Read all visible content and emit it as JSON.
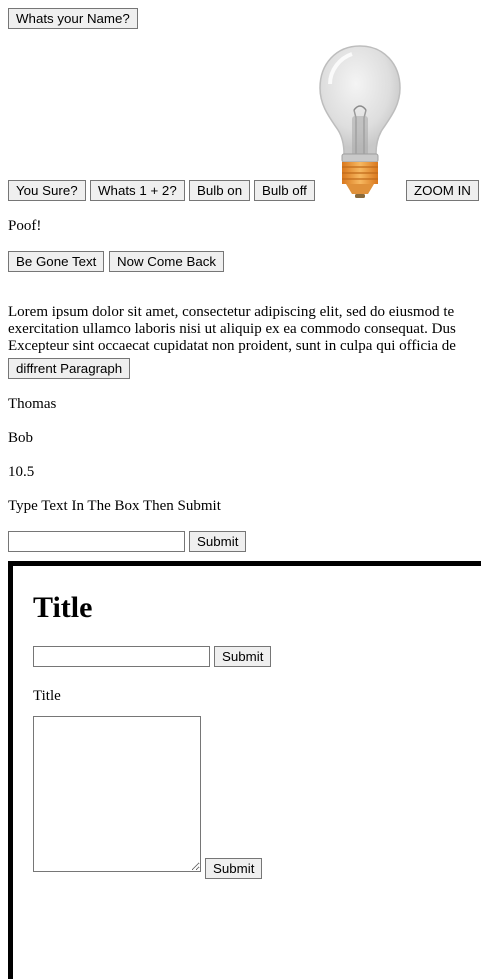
{
  "buttons": {
    "name": "Whats your Name?",
    "sure": "You Sure?",
    "math": "Whats 1 + 2?",
    "bulb_on": "Bulb on",
    "bulb_off": "Bulb off",
    "zoom_in": "ZOOM IN",
    "be_gone": "Be Gone Text",
    "come_back": "Now Come Back",
    "different_paragraph": "diffrent Paragraph",
    "submit": "Submit"
  },
  "texts": {
    "poof": "Poof!",
    "lorem_lines": [
      "Lorem ipsum dolor sit amet, consectetur adipiscing elit, sed do eiusmod te",
      "exercitation ullamco laboris nisi ut aliquip ex ea commodo consequat. Dus",
      "Excepteur sint occaecat cupidatat non proident, sunt in culpa qui officia de"
    ],
    "name1": "Thomas",
    "name2": "Bob",
    "number": "10.5",
    "instruction": "Type Text In The Box Then Submit"
  },
  "main_form": {
    "input_value": "",
    "submit_label": "Submit"
  },
  "frame": {
    "heading": "Title",
    "input_value": "",
    "submit_label": "Submit",
    "label": "Title",
    "textarea_value": "",
    "textarea_submit_label": "Submit"
  },
  "icons": {
    "bulb": "lightbulb-off-icon"
  },
  "colors": {
    "button_bg": "#efefef",
    "button_border": "#767676",
    "frame_border": "#000000",
    "bulb_base": "#f0a040"
  }
}
